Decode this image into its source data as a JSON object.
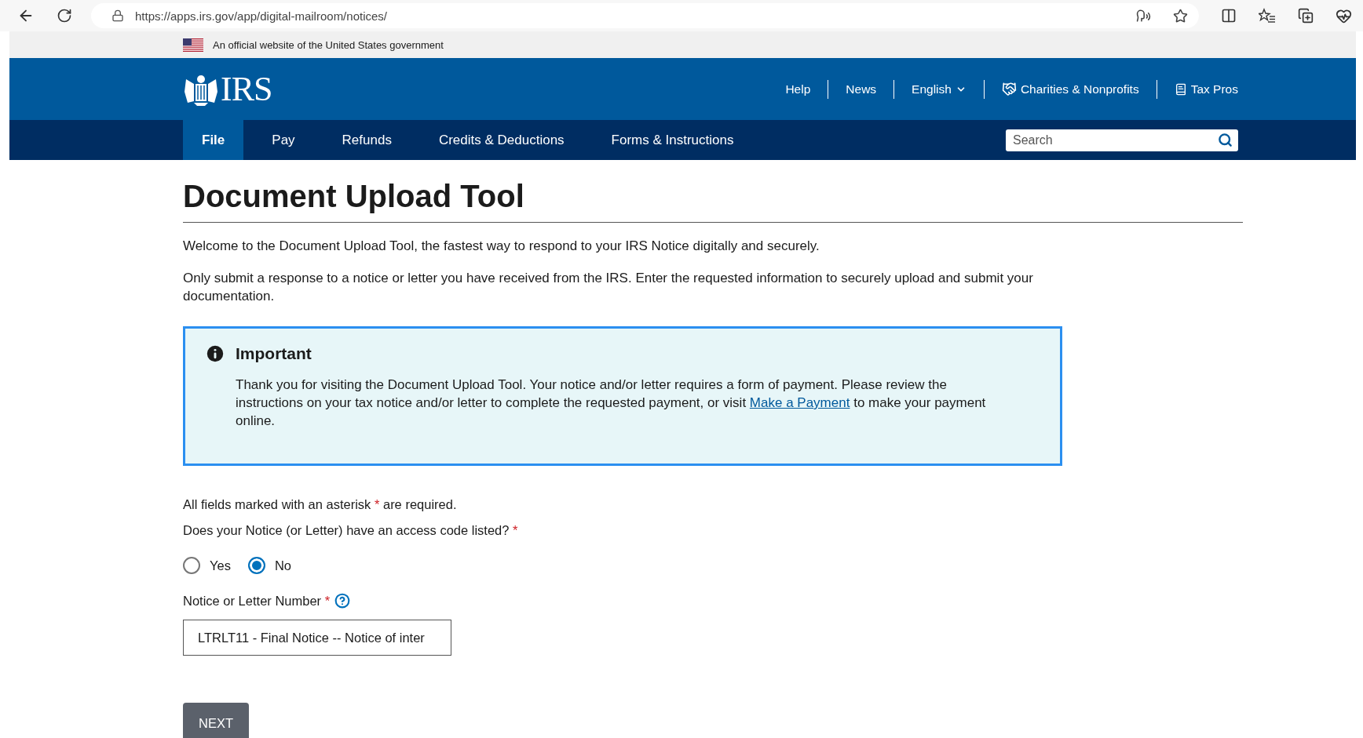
{
  "browser": {
    "url": "https://apps.irs.gov/app/digital-mailroom/notices/"
  },
  "gov_banner": {
    "text": "An official website of the United States government"
  },
  "header": {
    "logo": "IRS",
    "utility_links": [
      {
        "label": "Help",
        "kind": "plain"
      },
      {
        "label": "News",
        "kind": "plain"
      },
      {
        "label": "English",
        "kind": "dropdown"
      },
      {
        "label": "Charities & Nonprofits",
        "kind": "charities"
      },
      {
        "label": "Tax Pros",
        "kind": "taxpros"
      }
    ],
    "nav": [
      {
        "label": "File",
        "selected": true
      },
      {
        "label": "Pay",
        "selected": false
      },
      {
        "label": "Refunds",
        "selected": false
      },
      {
        "label": "Credits & Deductions",
        "selected": false
      },
      {
        "label": "Forms & Instructions",
        "selected": false
      }
    ],
    "search": {
      "placeholder": "Search"
    }
  },
  "page": {
    "title": "Document Upload Tool",
    "paragraphs": [
      "Welcome to the Document Upload Tool, the fastest way to respond to your IRS Notice digitally and securely.",
      "Only submit a response to a notice or letter you have received from the IRS. Enter the requested information to securely upload and submit your documentation."
    ],
    "alert": {
      "title": "Important",
      "text_before": "Thank you for visiting the Document Upload Tool. Your notice and/or letter requires a form of payment. Please review the instructions on your tax notice and/or letter to complete the requested payment, or visit",
      "link": "Make a Payment",
      "text_after": "to make your payment online."
    },
    "required_note": {
      "before": "All fields marked with an asterisk",
      "marker": "*",
      "after": "are required."
    },
    "question": {
      "label": "Does your Notice (or Letter) have an access code listed?",
      "marker": "*",
      "options": [
        {
          "label": "Yes",
          "selected": false
        },
        {
          "label": "No",
          "selected": true
        }
      ]
    },
    "notice_field": {
      "label": "Notice or Letter Number",
      "marker": "*",
      "value": "LTRLT11 - Final Notice -- Notice of inter"
    },
    "next_button": "NEXT"
  }
}
